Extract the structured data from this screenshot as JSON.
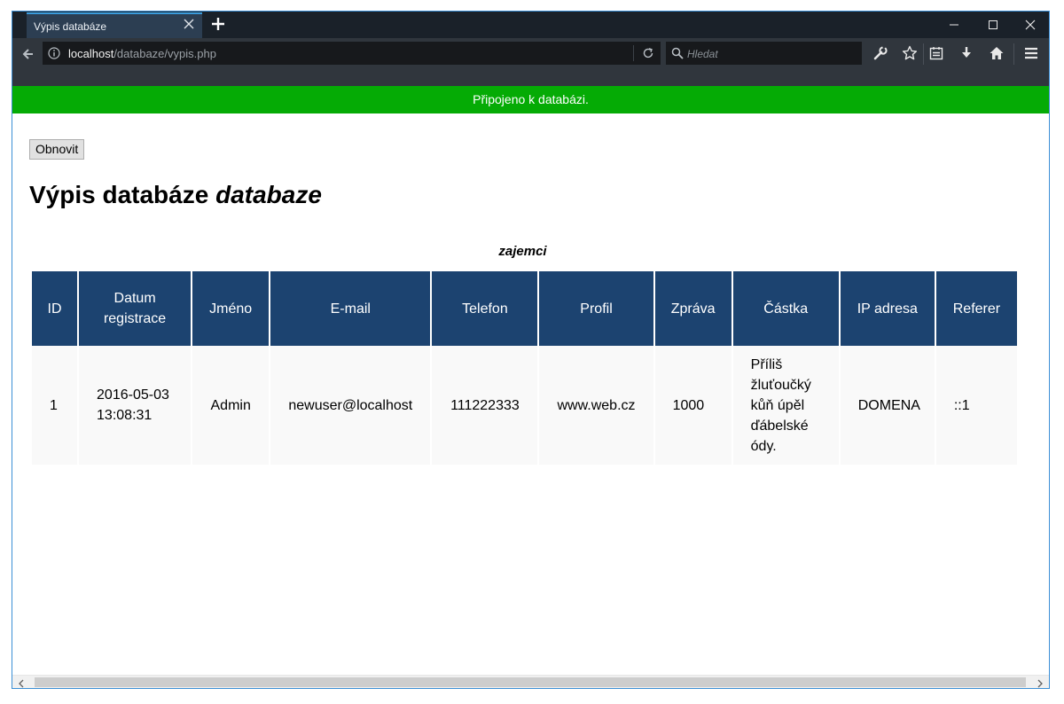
{
  "browser": {
    "tab_title": "Výpis databáze",
    "url_host": "localhost",
    "url_path": "/databaze/vypis.php",
    "search_placeholder": "Hledat"
  },
  "status_message": "Připojeno k databázi.",
  "refresh_button": "Obnovit",
  "heading": {
    "prefix": "Výpis databáze",
    "db_name": "databaze"
  },
  "table": {
    "caption": "zajemci",
    "headers": [
      "ID",
      "Datum registrace",
      "Jméno",
      "E-mail",
      "Telefon",
      "Profil",
      "Zpráva",
      "Částka",
      "IP adresa",
      "Referer"
    ],
    "rows": [
      [
        "1",
        "2016-05-03 13:08:31",
        "Admin",
        "newuser@localhost",
        "111222333",
        "www.web.cz",
        "1000",
        "Příliš žluťoučký kůň úpěl ďábelské ódy.",
        "DOMENA",
        "::1"
      ]
    ]
  },
  "colors": {
    "status_bar": "#05ab05",
    "table_header": "#1c4370",
    "row_background": "#f9f9f9",
    "tab_accent": "#3a9bdc"
  }
}
